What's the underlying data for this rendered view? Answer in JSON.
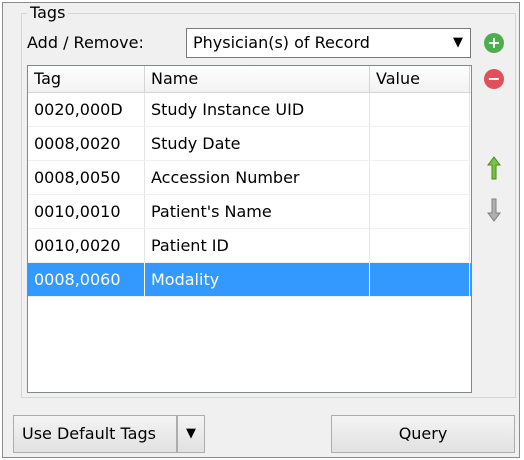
{
  "group": {
    "title": "Tags"
  },
  "add_remove": {
    "label": "Add / Remove:",
    "selected": "Physician(s) of Record",
    "arrow": "▼"
  },
  "icons": {
    "add": "plus-circle-icon",
    "remove": "minus-circle-icon",
    "up": "arrow-up-icon",
    "down": "arrow-down-icon"
  },
  "colors": {
    "add": "#4cae4c",
    "remove": "#e0505a",
    "up": "#7ac143",
    "down": "#a0a0a0",
    "selection": "#3399ff"
  },
  "table": {
    "headers": [
      "Tag",
      "Name",
      "Value"
    ],
    "rows": [
      {
        "tag": "0020,000D",
        "name": "Study Instance UID",
        "value": ""
      },
      {
        "tag": "0008,0020",
        "name": "Study Date",
        "value": ""
      },
      {
        "tag": "0008,0050",
        "name": "Accession Number",
        "value": ""
      },
      {
        "tag": "0010,0010",
        "name": "Patient's Name",
        "value": ""
      },
      {
        "tag": "0010,0020",
        "name": "Patient ID",
        "value": ""
      },
      {
        "tag": "0008,0060",
        "name": "Modality",
        "value": "",
        "selected": true
      }
    ]
  },
  "buttons": {
    "defaults": "Use Default Tags",
    "defaults_arrow": "▼",
    "query": "Query"
  }
}
